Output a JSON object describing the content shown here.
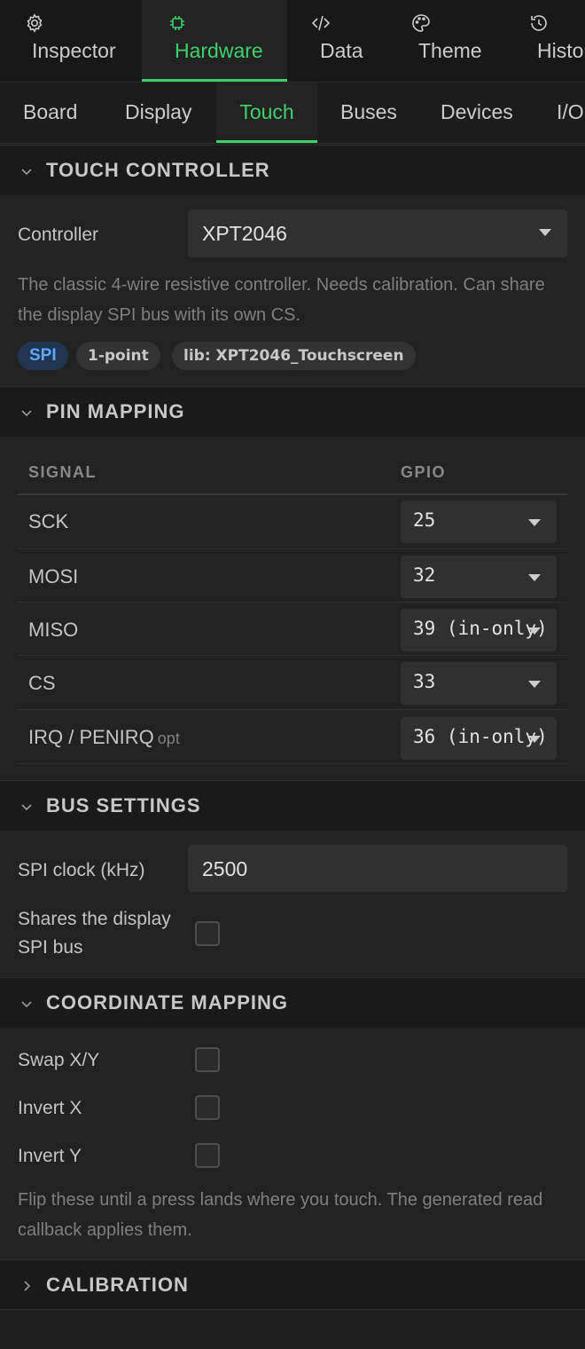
{
  "top_tabs": [
    {
      "label": "Inspector",
      "icon": "gear-icon"
    },
    {
      "label": "Hardware",
      "icon": "chip-icon",
      "active": true
    },
    {
      "label": "Data",
      "icon": "code-icon"
    },
    {
      "label": "Theme",
      "icon": "palette-icon"
    },
    {
      "label": "History",
      "icon": "history-icon"
    }
  ],
  "sub_tabs": [
    {
      "label": "Board"
    },
    {
      "label": "Display"
    },
    {
      "label": "Touch",
      "active": true
    },
    {
      "label": "Buses"
    },
    {
      "label": "Devices"
    },
    {
      "label": "I/O"
    }
  ],
  "touch_controller": {
    "title": "TOUCH CONTROLLER",
    "controller_label": "Controller",
    "controller_value": "XPT2046",
    "description": "The classic 4-wire resistive controller. Needs calibration. Can share the display SPI bus with its own CS.",
    "chips": [
      "SPI",
      "1-point",
      "lib: XPT2046_Touchscreen"
    ]
  },
  "pin_mapping": {
    "title": "PIN MAPPING",
    "col_signal": "SIGNAL",
    "col_gpio": "GPIO",
    "rows": [
      {
        "signal": "SCK",
        "gpio": "25"
      },
      {
        "signal": "MOSI",
        "gpio": "32"
      },
      {
        "signal": "MISO",
        "gpio": "39 (in-only)"
      },
      {
        "signal": "CS",
        "gpio": "33"
      },
      {
        "signal": "IRQ / PENIRQ",
        "optional": "opt",
        "gpio": "36 (in-only)"
      }
    ]
  },
  "bus_settings": {
    "title": "BUS SETTINGS",
    "clock_label": "SPI clock (kHz)",
    "clock_value": "2500",
    "shares_label_line1": "Shares the display",
    "shares_label_line2": "SPI bus",
    "shares_checked": false
  },
  "coordinate_mapping": {
    "title": "COORDINATE MAPPING",
    "swap_label": "Swap X/Y",
    "swap_checked": false,
    "invert_x_label": "Invert X",
    "invert_x_checked": false,
    "invert_y_label": "Invert Y",
    "invert_y_checked": false,
    "hint": "Flip these until a press lands where you touch. The generated read callback applies them."
  },
  "calibration": {
    "title": "CALIBRATION"
  },
  "colors": {
    "accent": "#3fcf6b",
    "background": "#1e1e1e",
    "panel": "#222222",
    "spi_chip_text": "#5fa8ff"
  }
}
